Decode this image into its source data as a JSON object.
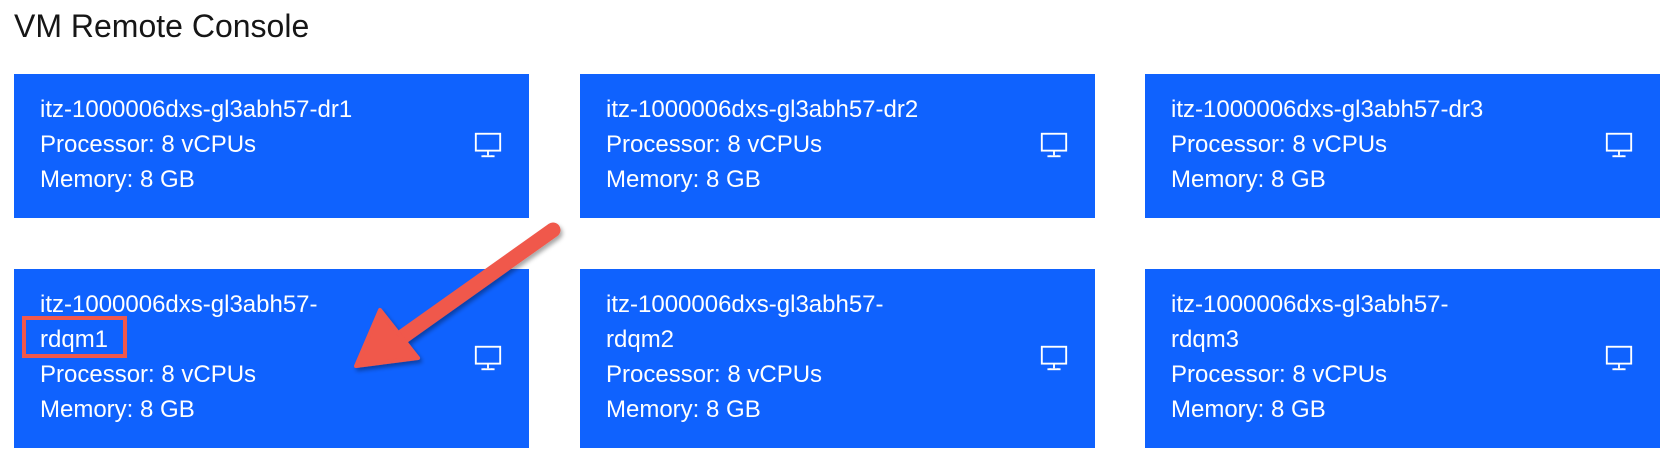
{
  "page": {
    "title": "VM Remote Console"
  },
  "tiles": [
    {
      "name_line1": "itz-1000006dxs-gl3abh57-dr1",
      "name_line2": "",
      "processor": "Processor: 8 vCPUs",
      "memory": "Memory: 8 GB",
      "icon": "monitor-icon"
    },
    {
      "name_line1": "itz-1000006dxs-gl3abh57-dr2",
      "name_line2": "",
      "processor": "Processor: 8 vCPUs",
      "memory": "Memory: 8 GB",
      "icon": "monitor-icon"
    },
    {
      "name_line1": "itz-1000006dxs-gl3abh57-dr3",
      "name_line2": "",
      "processor": "Processor: 8 vCPUs",
      "memory": "Memory: 8 GB",
      "icon": "monitor-icon"
    },
    {
      "name_line1": "itz-1000006dxs-gl3abh57-",
      "name_line2": "rdqm1",
      "processor": "Processor: 8 vCPUs",
      "memory": "Memory: 8 GB",
      "icon": "monitor-icon"
    },
    {
      "name_line1": "itz-1000006dxs-gl3abh57-",
      "name_line2": "rdqm2",
      "processor": "Processor: 8 vCPUs",
      "memory": "Memory: 8 GB",
      "icon": "monitor-icon"
    },
    {
      "name_line1": "itz-1000006dxs-gl3abh57-",
      "name_line2": "rdqm3",
      "processor": "Processor: 8 vCPUs",
      "memory": "Memory: 8 GB",
      "icon": "monitor-icon"
    }
  ],
  "colors": {
    "tile_background": "#0f62fe",
    "tile_text": "#ffffff",
    "annotation": "#f0584c"
  }
}
